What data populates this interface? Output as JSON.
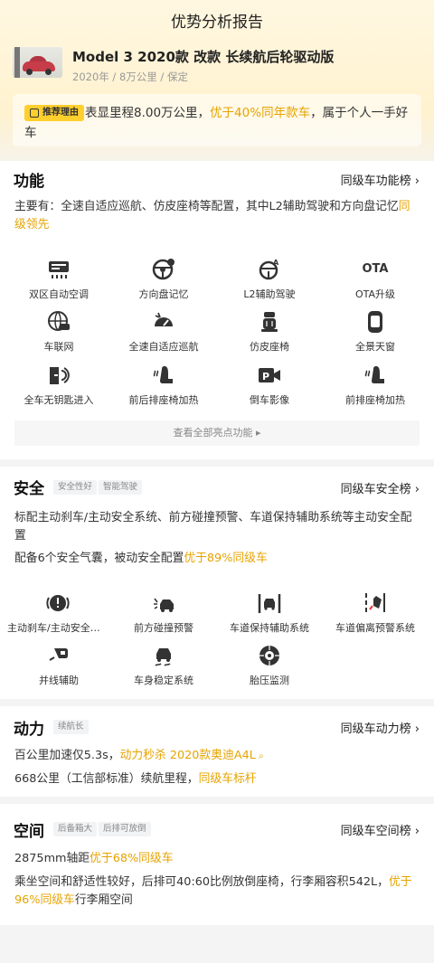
{
  "header": {
    "title": "优势分析报告"
  },
  "car": {
    "name": "Model 3 2020款 改款 长续航后轮驱动版",
    "meta": "2020年 / 8万公里 / 保定"
  },
  "recommend": {
    "badge": "推荐理由",
    "text_a": "表显里程8.00万公里，",
    "text_hl": "优于40%同年款车",
    "text_b": "，属于个人一手好车"
  },
  "function": {
    "title": "功能",
    "link": "同级车功能榜 ›",
    "desc": "主要有：全速自适应巡航、仿皮座椅等配置，其中L2辅助驾驶和方向盘记忆",
    "desc_hl": "同级领先",
    "items": [
      {
        "label": "双区自动空调",
        "icon": "ac-icon"
      },
      {
        "label": "方向盘记忆",
        "icon": "steering-wheel-icon"
      },
      {
        "label": "L2辅助驾驶",
        "icon": "assisted-driving-icon"
      },
      {
        "label": "OTA升级",
        "icon": "ota-icon",
        "text": "OTA"
      },
      {
        "label": "车联网",
        "icon": "connected-car-icon"
      },
      {
        "label": "全速自适应巡航",
        "icon": "cruise-icon"
      },
      {
        "label": "仿皮座椅",
        "icon": "leather-seat-icon"
      },
      {
        "label": "全景天窗",
        "icon": "sunroof-icon"
      },
      {
        "label": "全车无钥匙进入",
        "icon": "keyless-door-icon"
      },
      {
        "label": "前后排座椅加热",
        "icon": "seat-heating-icon"
      },
      {
        "label": "倒车影像",
        "icon": "reverse-camera-icon"
      },
      {
        "label": "前排座椅加热",
        "icon": "front-seat-heating-icon"
      }
    ],
    "see_all": "查看全部亮点功能 ▸"
  },
  "safety": {
    "title": "安全",
    "tags": [
      "安全性好",
      "智能驾驶"
    ],
    "link": "同级车安全榜 ›",
    "desc1": "标配主动刹车/主动安全系统、前方碰撞预警、车道保持辅助系统等主动安全配置",
    "desc2_a": "配备6个安全气囊，被动安全配置",
    "desc2_hl": "优于89%同级车",
    "items": [
      {
        "label": "主动刹车/主动安全系统",
        "icon": "brake-icon"
      },
      {
        "label": "前方碰撞预警",
        "icon": "collision-warning-icon"
      },
      {
        "label": "车道保持辅助系统",
        "icon": "lane-keep-icon"
      },
      {
        "label": "车道偏离预警系统",
        "icon": "lane-departure-icon"
      },
      {
        "label": "并线辅助",
        "icon": "blind-spot-icon"
      },
      {
        "label": "车身稳定系统",
        "icon": "stability-icon"
      },
      {
        "label": "胎压监测",
        "icon": "tire-pressure-icon"
      }
    ]
  },
  "power": {
    "title": "动力",
    "tags": [
      "续航长"
    ],
    "link": "同级车动力榜 ›",
    "line1_a": "百公里加速仅5.3s，",
    "line1_hl": "动力秒杀 2020款奥迪A4L",
    "line2_a": "668公里（工信部标准）续航里程，",
    "line2_hl": "同级车标杆"
  },
  "space": {
    "title": "空间",
    "tags": [
      "后备箱大",
      "后排可放倒"
    ],
    "link": "同级车空间榜 ›",
    "line1_a": "2875mm轴距",
    "line1_hl": "优于68%同级车",
    "line2_a": "乘坐空间和舒适性较好，后排可40:60比例放倒座椅，行李厢容积542L，",
    "line2_hl": "优于96%同级车",
    "line2_b": "行李厢空间"
  },
  "colors": {
    "accent": "#e6a300",
    "badge": "#ffcf2e"
  }
}
